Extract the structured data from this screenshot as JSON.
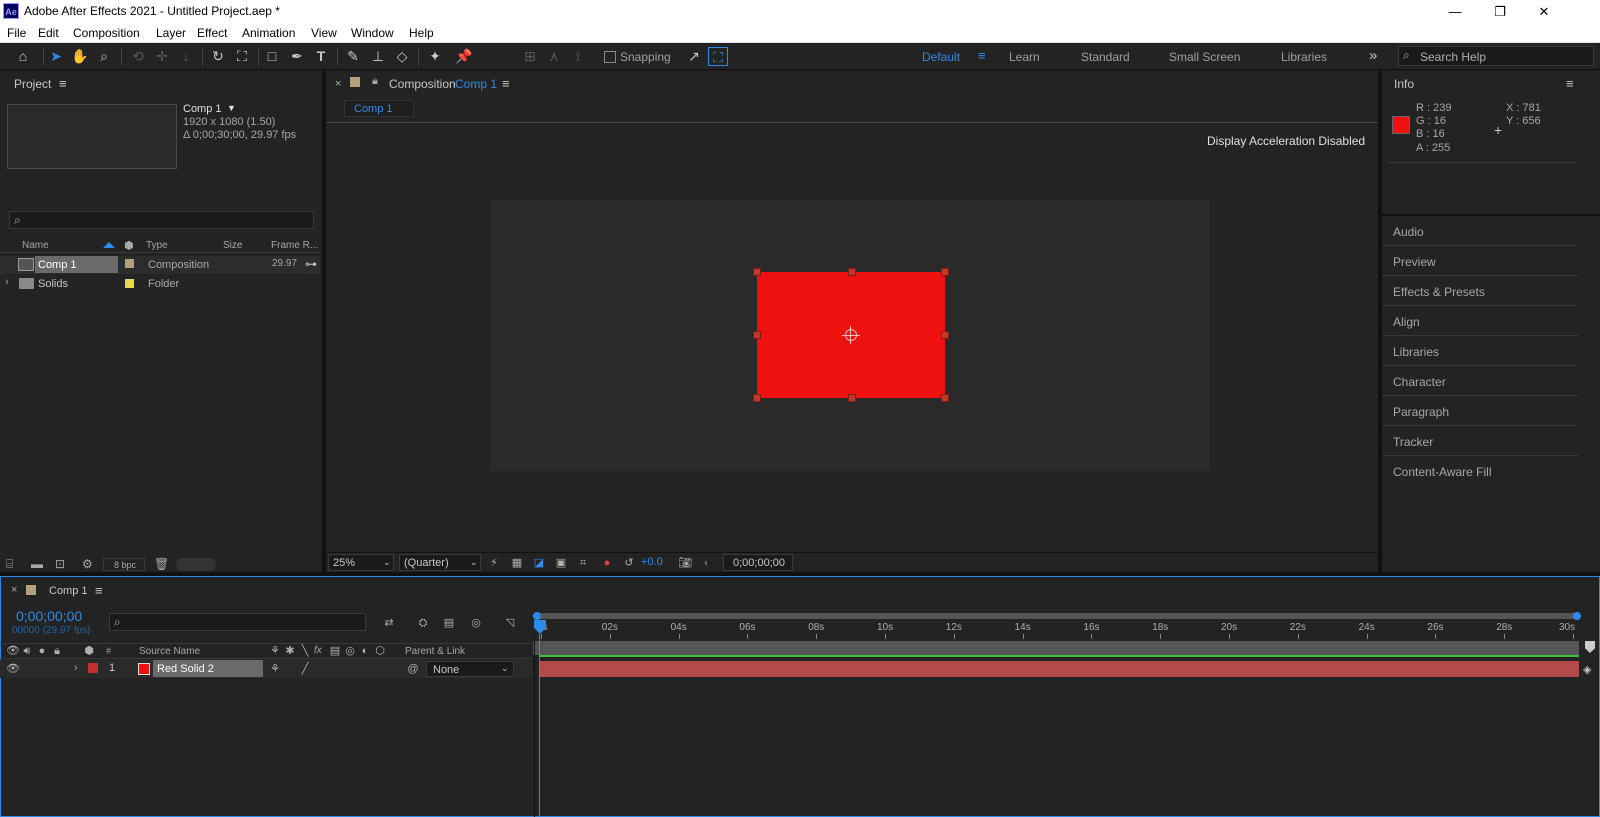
{
  "window": {
    "app_icon_text": "Ae",
    "title": "Adobe After Effects 2021 - Untitled Project.aep *",
    "min_label": "—",
    "max_label": "❐",
    "close_label": "✕"
  },
  "menu": [
    "File",
    "Edit",
    "Composition",
    "Layer",
    "Effect",
    "Animation",
    "View",
    "Window",
    "Help"
  ],
  "toolbar": {
    "snapping_label": "Snapping",
    "workspaces": [
      "Default",
      "Learn",
      "Standard",
      "Small Screen",
      "Libraries"
    ],
    "more_label": "»",
    "search_placeholder": "Search Help"
  },
  "project": {
    "panel_title": "Project",
    "comp_name": "Comp 1",
    "comp_size": "1920 x 1080 (1.50)",
    "comp_duration": "Δ 0;00;30;00, 29.97 fps",
    "columns": [
      "Name",
      "Type",
      "Size",
      "Frame R..."
    ],
    "items": [
      {
        "name": "Comp 1",
        "type": "Composition",
        "frame_rate": "29.97",
        "label_color": "#b4a07a"
      },
      {
        "name": "Solids",
        "type": "Folder",
        "frame_rate": "",
        "label_color": "#e8d94a"
      }
    ],
    "bpc_label": "8 bpc"
  },
  "composition": {
    "panel_prefix": "Composition",
    "panel_name": "Comp 1",
    "tab_label": "Comp 1",
    "notice": "Display Acceleration Disabled",
    "zoom": "25%",
    "resolution": "(Quarter)",
    "exposure": "+0.0",
    "timecode": "0;00;00;00",
    "solid_color": "#ef1010"
  },
  "info": {
    "panel_title": "Info",
    "r": "R : 239",
    "g": "G : 16",
    "b": "B : 16",
    "a": "A : 255",
    "x": "X : 781",
    "y": "Y : 656",
    "swatch_color": "#ef1010"
  },
  "right_panels": [
    "Audio",
    "Preview",
    "Effects & Presets",
    "Align",
    "Libraries",
    "Character",
    "Paragraph",
    "Tracker",
    "Content-Aware Fill"
  ],
  "timeline": {
    "tab_label": "Comp 1",
    "timecode": "0;00;00;00",
    "frame_info": "00000 (29.97 fps)",
    "source_name_header": "Source Name",
    "parent_header": "Parent & Link",
    "num_header": "#",
    "ticks": [
      "0s",
      "02s",
      "04s",
      "06s",
      "08s",
      "10s",
      "12s",
      "14s",
      "16s",
      "18s",
      "20s",
      "22s",
      "24s",
      "26s",
      "28s",
      "30s"
    ],
    "layers": [
      {
        "index": "1",
        "name": "Red Solid 2",
        "parent": "None",
        "color": "#ef1010"
      }
    ]
  }
}
